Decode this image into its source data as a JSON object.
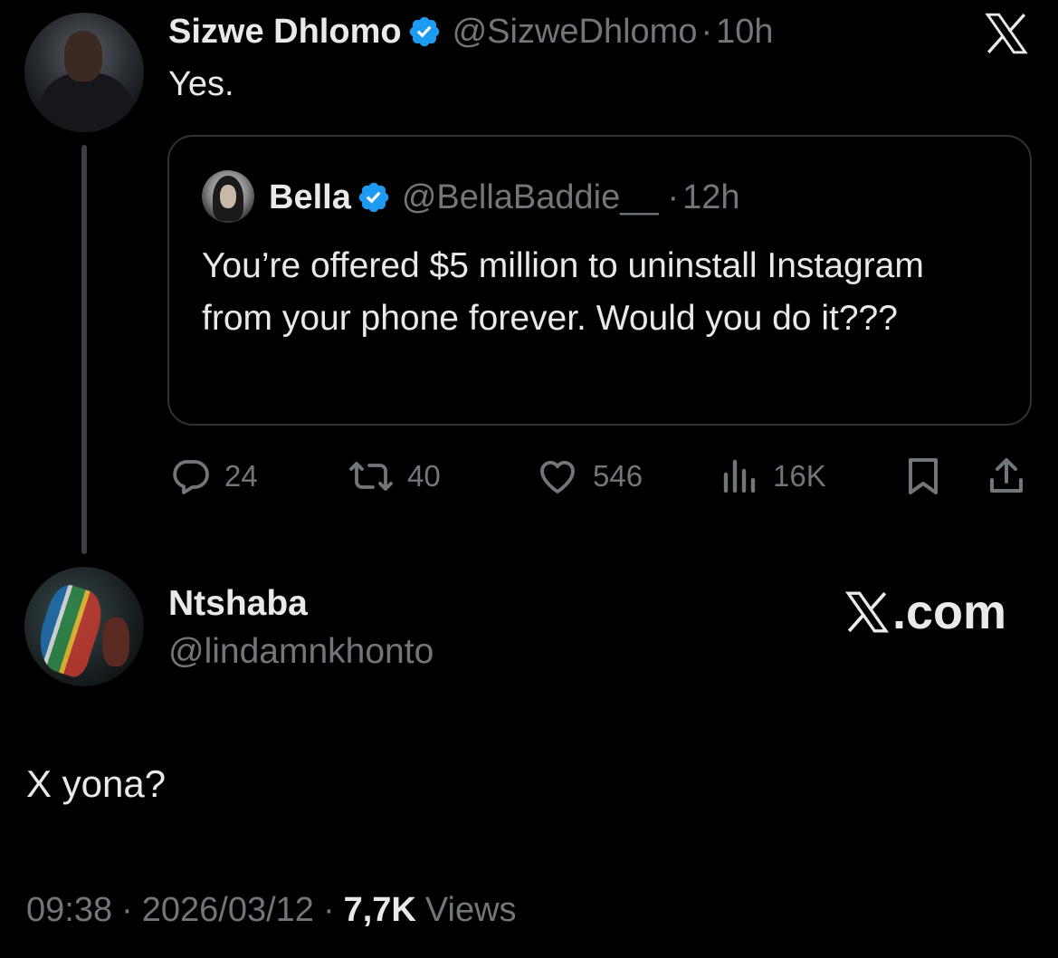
{
  "parent_tweet": {
    "author_name": "Sizwe Dhlomo",
    "handle": "@SizweDhlomo",
    "separator": "·",
    "time": "10h",
    "text": "Yes.",
    "verified": true
  },
  "quoted_tweet": {
    "author_name": "Bella",
    "handle": "@BellaBaddie__",
    "separator": "·",
    "time": "12h",
    "text": "You’re offered $5 million to uninstall Instagram from your phone forever. Would you do it???",
    "verified": true
  },
  "actions": {
    "replies": "24",
    "reposts": "40",
    "likes": "546",
    "views": "16K"
  },
  "reply_tweet": {
    "author_name": "Ntshaba",
    "handle": "@lindamnkhonto",
    "brand": ".com",
    "text": "X yona?",
    "timestamp": "09:38",
    "date": "2026/03/12",
    "views_count": "7,7K",
    "views_label": "Views",
    "separator": "·"
  },
  "colors": {
    "background": "#000000",
    "text_primary": "#e7e9ea",
    "text_muted": "#71767b",
    "verified_blue": "#1d9bf0",
    "border": "#2f3336"
  },
  "icons": [
    "x-logo-icon",
    "verified-badge-icon",
    "reply-icon",
    "repost-icon",
    "like-icon",
    "views-icon",
    "bookmark-icon",
    "share-icon"
  ]
}
